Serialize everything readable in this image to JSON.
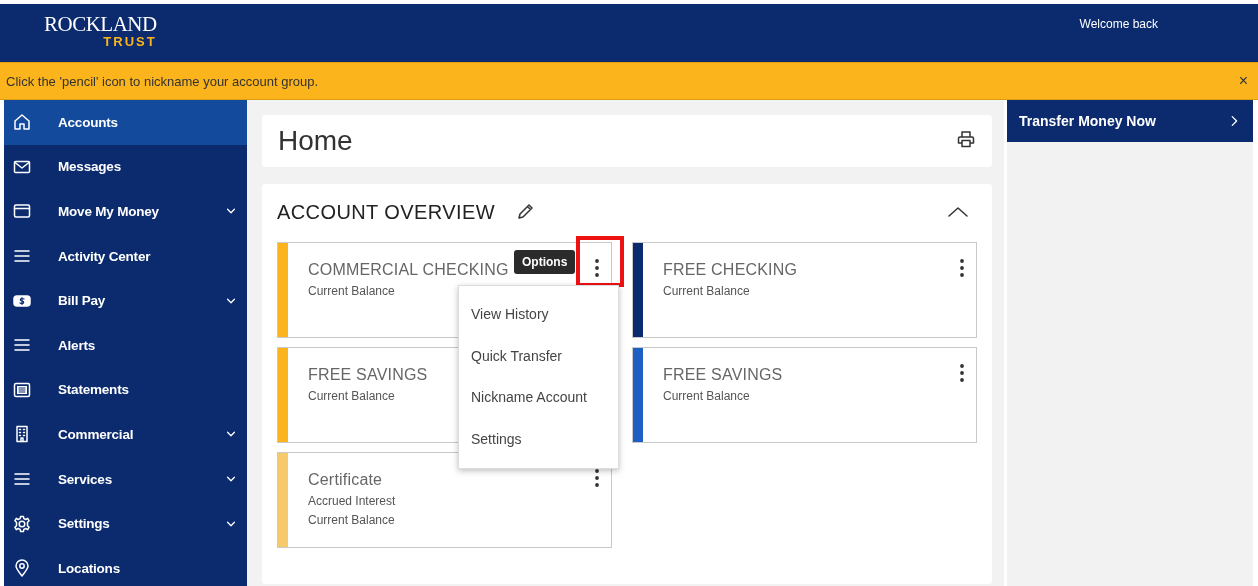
{
  "header": {
    "logo_top": "ROCKLAND",
    "logo_bottom": "TRUST",
    "greeting": "Welcome back"
  },
  "notice": {
    "text": "Click the 'pencil' icon to nickname your account group.",
    "close": "×"
  },
  "sidebar": {
    "items": [
      {
        "label": "Accounts",
        "selected": true,
        "expandable": false
      },
      {
        "label": "Messages",
        "selected": false,
        "expandable": false
      },
      {
        "label": "Move My Money",
        "selected": false,
        "expandable": true
      },
      {
        "label": "Activity Center",
        "selected": false,
        "expandable": false
      },
      {
        "label": "Bill Pay",
        "selected": false,
        "expandable": true
      },
      {
        "label": "Alerts",
        "selected": false,
        "expandable": false
      },
      {
        "label": "Statements",
        "selected": false,
        "expandable": false
      },
      {
        "label": "Commercial",
        "selected": false,
        "expandable": true
      },
      {
        "label": "Services",
        "selected": false,
        "expandable": true
      },
      {
        "label": "Settings",
        "selected": false,
        "expandable": true
      },
      {
        "label": "Locations",
        "selected": false,
        "expandable": false
      }
    ]
  },
  "page_title": "Home",
  "account_overview": {
    "title": "ACCOUNT OVERVIEW",
    "expanded": true,
    "accounts": [
      {
        "name": "COMMERCIAL CHECKING",
        "details": [
          "Current Balance"
        ],
        "color": "#fbb41b",
        "menu_open": true
      },
      {
        "name": "FREE CHECKING",
        "details": [
          "Current Balance"
        ],
        "color": "#0b2b6e",
        "menu_open": false
      },
      {
        "name": "FREE SAVINGS",
        "details": [
          "Current Balance"
        ],
        "color": "#fbb41b",
        "menu_open": false
      },
      {
        "name": "FREE SAVINGS",
        "details": [
          "Current Balance"
        ],
        "color": "#1d5fc2",
        "menu_open": false
      },
      {
        "name": "Certificate",
        "details": [
          "Accrued Interest",
          "Current Balance"
        ],
        "color": "#f6ca6a",
        "menu_open": false
      }
    ],
    "tooltip": "Options",
    "menu": [
      "View History",
      "Quick Transfer",
      "Nickname Account",
      "Settings"
    ]
  },
  "right_panel": {
    "transfer_button": "Transfer Money Now"
  }
}
